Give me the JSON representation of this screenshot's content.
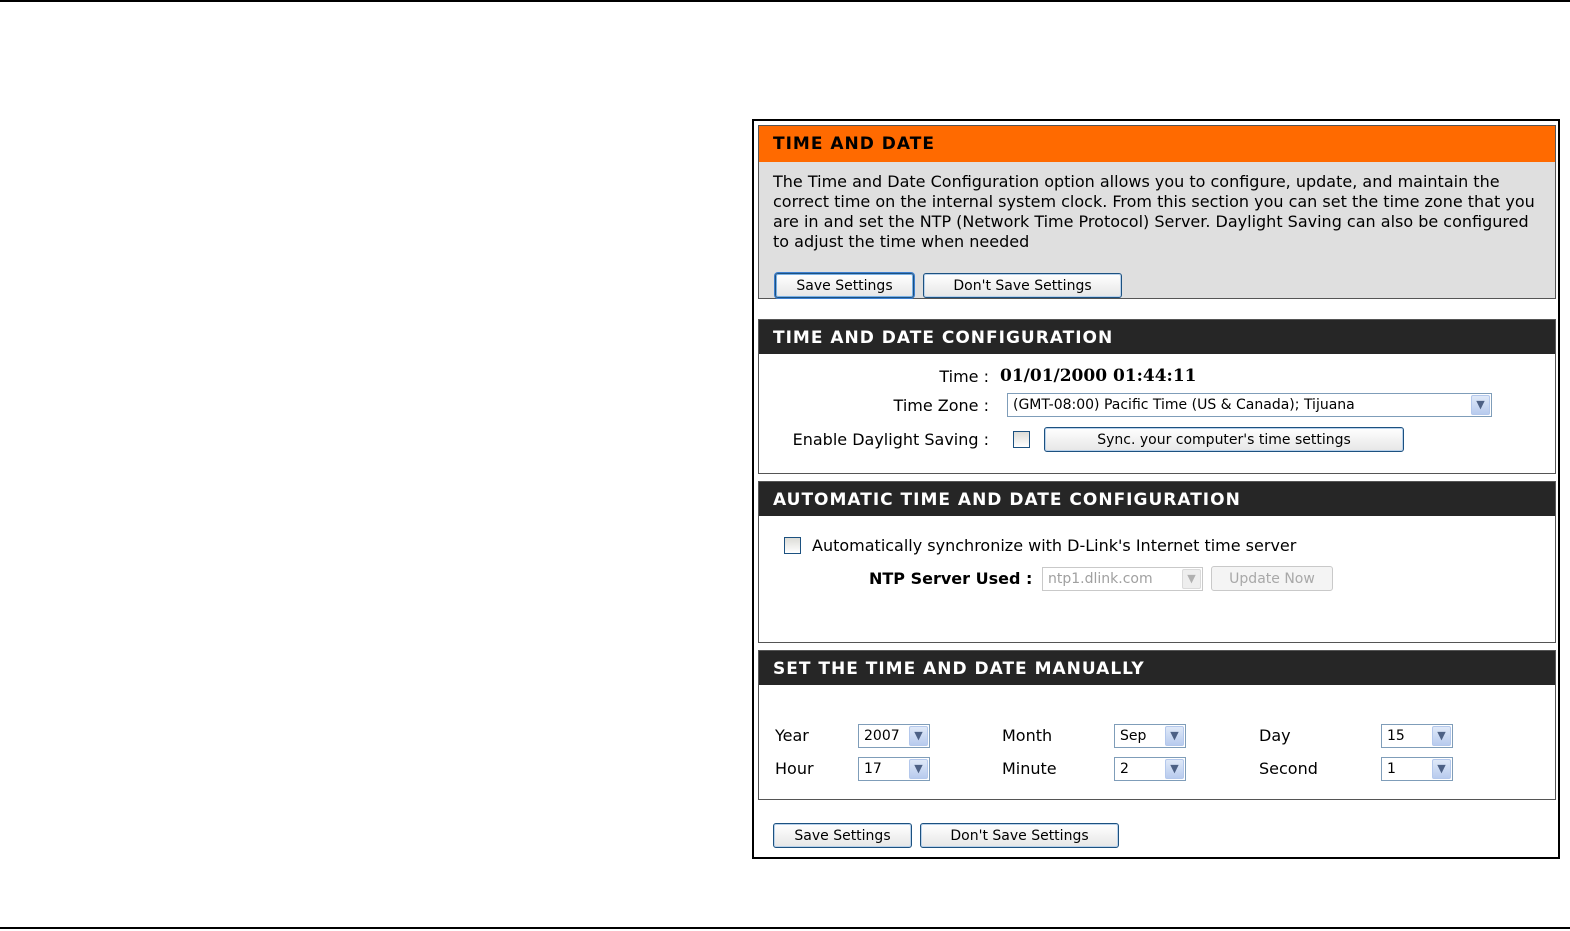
{
  "intro": {
    "title": "TIME AND DATE",
    "description": "The Time and Date Configuration option allows you to configure, update, and maintain the correct time on the internal system clock. From this section you can set the time zone that you are in and set the NTP (Network Time Protocol) Server. Daylight Saving can also be configured to adjust the time when needed",
    "save_label": "Save Settings",
    "dont_save_label": "Don't Save Settings"
  },
  "config": {
    "title": "TIME AND DATE CONFIGURATION",
    "time_label": "Time :",
    "time_value": "01/01/2000 01:44:11",
    "timezone_label": "Time Zone :",
    "timezone_value": "(GMT-08:00) Pacific Time (US & Canada); Tijuana",
    "daylight_label": "Enable Daylight Saving :",
    "daylight_checked": false,
    "sync_label": "Sync. your computer's time settings"
  },
  "auto": {
    "title": "AUTOMATIC TIME AND DATE CONFIGURATION",
    "auto_sync_label": "Automatically synchronize with D-Link's Internet time server",
    "auto_sync_checked": false,
    "ntp_label": "NTP Server Used :",
    "ntp_value": "ntp1.dlink.com",
    "update_label": "Update Now"
  },
  "manual": {
    "title": "SET THE TIME AND DATE MANUALLY",
    "year_label": "Year",
    "year_value": "2007",
    "month_label": "Month",
    "month_value": "Sep",
    "day_label": "Day",
    "day_value": "15",
    "hour_label": "Hour",
    "hour_value": "17",
    "minute_label": "Minute",
    "minute_value": "2",
    "second_label": "Second",
    "second_value": "1"
  },
  "footer": {
    "save_label": "Save Settings",
    "dont_save_label": "Don't Save Settings"
  },
  "colors": {
    "accent_orange": "#ff6a00",
    "header_dark": "#262626",
    "intro_bg": "#dfdfdf"
  }
}
